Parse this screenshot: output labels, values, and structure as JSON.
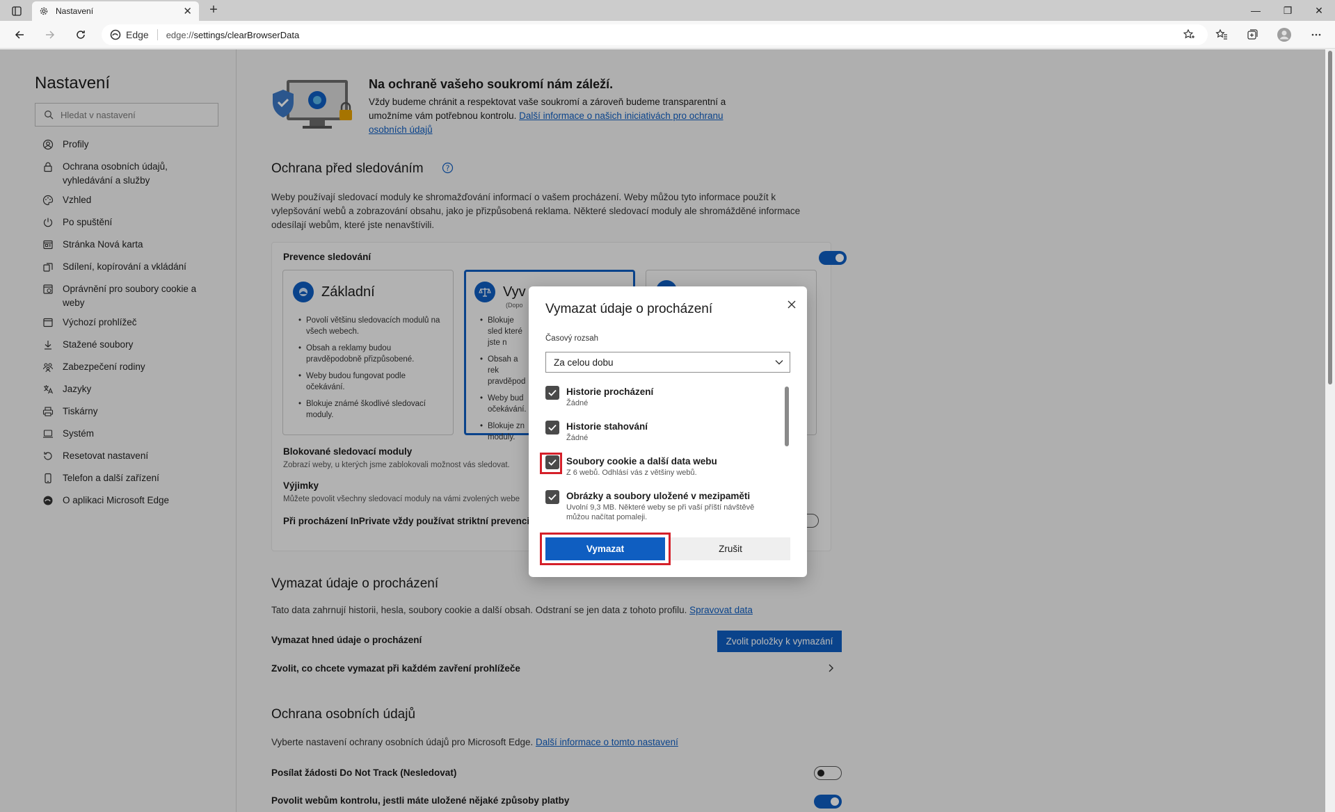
{
  "browser": {
    "tab_title": "Nastavení",
    "site_label": "Edge",
    "url_prefix": "edge://",
    "url_path": "settings/clearBrowserData"
  },
  "sidebar": {
    "title": "Nastavení",
    "search_placeholder": "Hledat v nastavení",
    "items": [
      {
        "label": "Profily",
        "icon": "profile-icon"
      },
      {
        "label": "Ochrana osobních údajů, vyhledávání a služby",
        "icon": "lock-icon"
      },
      {
        "label": "Vzhled",
        "icon": "appearance-icon"
      },
      {
        "label": "Po spuštění",
        "icon": "power-icon"
      },
      {
        "label": "Stránka Nová karta",
        "icon": "new-tab-page-icon"
      },
      {
        "label": "Sdílení, kopírování a vkládání",
        "icon": "share-icon"
      },
      {
        "label": "Oprávnění pro soubory cookie a weby",
        "icon": "cookie-permissions-icon"
      },
      {
        "label": "Výchozí prohlížeč",
        "icon": "default-browser-icon"
      },
      {
        "label": "Stažené soubory",
        "icon": "download-icon"
      },
      {
        "label": "Zabezpečení rodiny",
        "icon": "family-icon"
      },
      {
        "label": "Jazyky",
        "icon": "language-icon"
      },
      {
        "label": "Tiskárny",
        "icon": "printer-icon"
      },
      {
        "label": "Systém",
        "icon": "system-icon"
      },
      {
        "label": "Resetovat nastavení",
        "icon": "reset-icon"
      },
      {
        "label": "Telefon a další zařízení",
        "icon": "phone-icon"
      },
      {
        "label": "O aplikaci Microsoft Edge",
        "icon": "edge-logo-icon"
      }
    ]
  },
  "hero": {
    "title": "Na ochraně vašeho soukromí nám záleží.",
    "desc": "Vždy budeme chránit a respektovat vaše soukromí a zároveň budeme transparentní a umožníme vám potřebnou kontrolu. ",
    "link": "Další informace o našich iniciativách pro ochranu osobních údajů"
  },
  "tracking": {
    "title": "Ochrana před sledováním",
    "desc": "Weby používají sledovací moduly ke shromažďování informací o vašem procházení. Weby můžou tyto informace použít k vylepšování webů a zobrazování obsahu, jako je přizpůsobená reklama. Některé sledovací moduly ale shromážděné informace odesílají webům, které jste nenavštívili.",
    "prevention_label": "Prevence sledování",
    "options": {
      "basic": {
        "title": "Základní",
        "bullets": [
          "Povolí většinu sledovacích modulů na všech webech.",
          "Obsah a reklamy budou pravděpodobně přizpůsobené.",
          "Weby budou fungovat podle očekávání.",
          "Blokuje známé škodlivé sledovací moduly."
        ]
      },
      "balanced": {
        "title": "Vyv",
        "sub": "(Dopo",
        "bullets": [
          "Blokuje sled které jste n",
          "Obsah a rek pravděpod",
          "Weby bud očekávání.",
          "Blokuje zn moduly."
        ]
      }
    },
    "blocked_title": "Blokované sledovací moduly",
    "blocked_desc": "Zobrazí weby, u kterých jsme zablokovali možnost vás sledovat.",
    "exceptions_title": "Výjimky",
    "exceptions_desc": "Můžete povolit všechny sledovací moduly na vámi zvolených webe",
    "inprivate_label": "Při procházení InPrivate vždy používat striktní prevenci s"
  },
  "clear_section": {
    "title": "Vymazat údaje o procházení",
    "desc": "Tato data zahrnují historii, hesla, soubory cookie a další obsah. Odstraní se jen data z tohoto profilu. ",
    "link": "Spravovat data",
    "now_label": "Vymazat hned údaje o procházení",
    "choose_button": "Zvolit položky k vymazání",
    "on_close_label": "Zvolit, co chcete vymazat při každém zavření prohlížeče"
  },
  "privacy_section": {
    "title": "Ochrana osobních údajů",
    "desc": "Vyberte nastavení ochrany osobních údajů pro Microsoft Edge. ",
    "link": "Další informace o tomto nastavení",
    "dnt_label": "Posílat žádosti Do Not Track (Nesledovat)",
    "payment_label": "Povolit webům kontrolu, jestli máte uložené nějaké způsoby platby"
  },
  "dialog": {
    "title": "Vymazat údaje o procházení",
    "range_label": "Časový rozsah",
    "range_value": "Za celou dobu",
    "items": [
      {
        "label": "Historie procházení",
        "desc": "Žádné"
      },
      {
        "label": "Historie stahování",
        "desc": "Žádné"
      },
      {
        "label": "Soubory cookie a další data webu",
        "desc": "Z 6 webů. Odhlásí vás z většiny webů."
      },
      {
        "label": "Obrázky a soubory uložené v mezipaměti",
        "desc": "Uvolní 9,3 MB. Některé weby se při vaší příští návštěvě můžou načítat pomaleji."
      }
    ],
    "clear_button": "Vymazat",
    "cancel_button": "Zrušit"
  },
  "colors": {
    "accent": "#0f5ec1",
    "highlight": "#d5202a"
  }
}
